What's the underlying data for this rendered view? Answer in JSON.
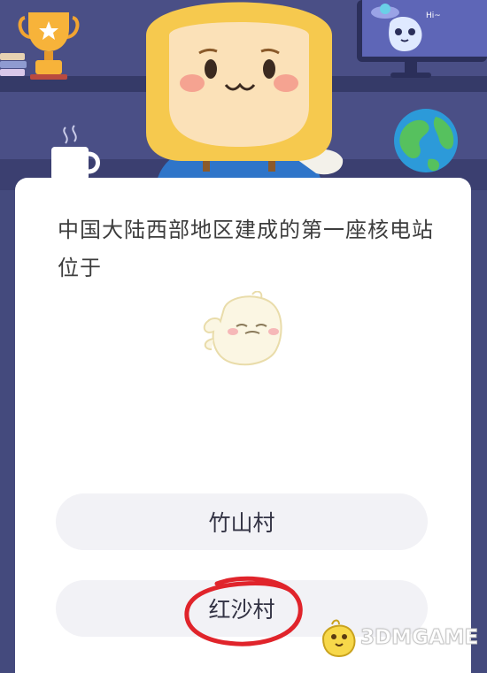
{
  "quiz": {
    "question": "中国大陆西部地区建成的第一座核电站位于",
    "options": [
      {
        "label": "竹山村"
      },
      {
        "label": "红沙村"
      }
    ],
    "marked_option_index": 1
  },
  "header": {
    "monitor_text": "Hi~"
  },
  "watermark": {
    "text": "3DMGAME"
  },
  "colors": {
    "background": "#4a4f86",
    "card": "#ffffff",
    "option_bg": "#f2f2f6",
    "question_text": "#3d3d3d",
    "mark_red": "#e0242b",
    "character_yellow": "#f6c94e"
  }
}
